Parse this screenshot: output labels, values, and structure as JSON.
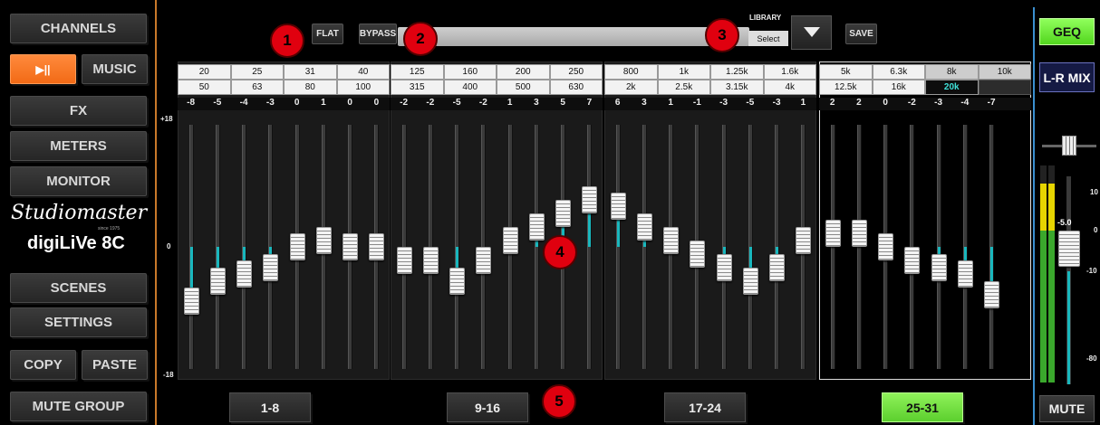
{
  "nav": {
    "channels": "CHANNELS",
    "play_icon": "▶||",
    "music": "MUSIC",
    "fx": "FX",
    "meters": "METERS",
    "monitor": "MONITOR",
    "brand_logo": "Studiomaster",
    "brand_since": "since 1975",
    "model_logo": "digiLiVe 8C",
    "scenes": "SCENES",
    "settings": "SETTINGS",
    "copy": "COPY",
    "paste": "PASTE",
    "mute_group": "MUTE GROUP"
  },
  "toolbar": {
    "flat": "FLAT",
    "bypass": "BYPASS",
    "library_label": "LIBRARY",
    "library_select": "Select",
    "save": "SAVE"
  },
  "markers": [
    "1",
    "2",
    "3",
    "4",
    "5"
  ],
  "scale": {
    "top": "+18",
    "mid": "0",
    "bottom": "-18"
  },
  "eq": {
    "panels": [
      {
        "freqs_top": [
          "20",
          "25",
          "31",
          "40"
        ],
        "freqs_bottom": [
          "50",
          "63",
          "80",
          "100"
        ],
        "gains": [
          "-8",
          "-5",
          "-4",
          "-3",
          "0",
          "1",
          "0",
          "0"
        ]
      },
      {
        "freqs_top": [
          "125",
          "160",
          "200",
          "250"
        ],
        "freqs_bottom": [
          "315",
          "400",
          "500",
          "630"
        ],
        "gains": [
          "-2",
          "-2",
          "-5",
          "-2",
          "1",
          "3",
          "5",
          "7"
        ]
      },
      {
        "freqs_top": [
          "800",
          "1k",
          "1.25k",
          "1.6k"
        ],
        "freqs_bottom": [
          "2k",
          "2.5k",
          "3.15k",
          "4k"
        ],
        "gains": [
          "6",
          "3",
          "1",
          "-1",
          "-3",
          "-5",
          "-3",
          "1"
        ]
      },
      {
        "freqs_top": [
          "5k",
          "6.3k",
          "8k",
          "10k"
        ],
        "freqs_bottom": [
          "12.5k",
          "16k",
          "20k",
          ""
        ],
        "gains": [
          "2",
          "2",
          "0",
          "-2",
          "-3",
          "-4",
          "-7"
        ],
        "selected_freq": "20k"
      }
    ],
    "pages": [
      "1-8",
      "9-16",
      "17-24",
      "25-31"
    ],
    "active_page": "25-31"
  },
  "right": {
    "geq": "GEQ",
    "lr_mix": "L-R MIX",
    "fader_value": "-5.0",
    "scale": [
      "10",
      "0",
      "-10",
      "-80"
    ],
    "mute": "MUTE"
  },
  "colors": {
    "accent_orange": "#f26a16",
    "active_green": "#5ccf2e",
    "marker_red": "#e0000f",
    "gain_bar": "#19b7bd"
  }
}
